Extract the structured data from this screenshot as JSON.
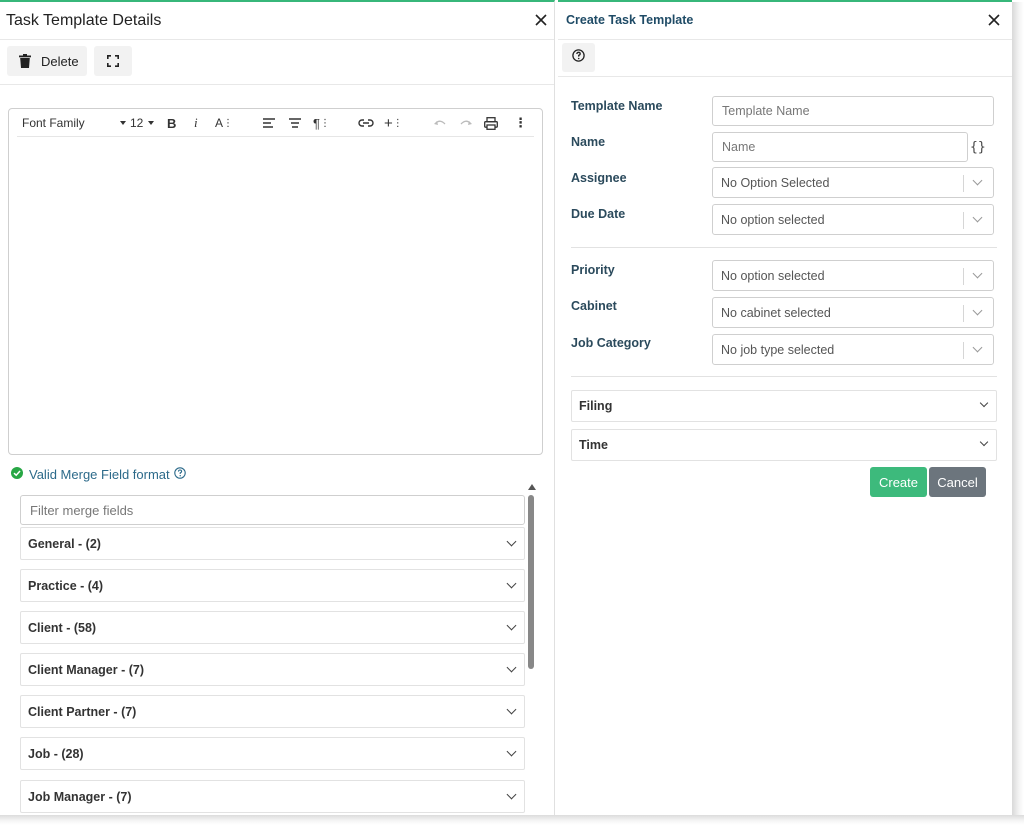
{
  "left_panel": {
    "title": "Task Template Details",
    "toolbar": {
      "delete_label": "Delete"
    },
    "editor_toolbar": {
      "font_family": "Font Family",
      "font_size": "12"
    },
    "merge": {
      "status_text": "Valid Merge Field format",
      "filter_placeholder": "Filter merge fields",
      "groups": [
        {
          "label": "General - (2)"
        },
        {
          "label": "Practice - (4)"
        },
        {
          "label": "Client - (58)"
        },
        {
          "label": "Client Manager - (7)"
        },
        {
          "label": "Client Partner - (7)"
        },
        {
          "label": "Job - (28)"
        },
        {
          "label": "Job Manager - (7)"
        }
      ]
    }
  },
  "right_panel": {
    "title": "Create Task Template",
    "fields": {
      "template_name": {
        "label": "Template Name",
        "placeholder": "Template Name"
      },
      "name": {
        "label": "Name",
        "placeholder": "Name"
      },
      "assignee": {
        "label": "Assignee",
        "value": "No Option Selected"
      },
      "due_date": {
        "label": "Due Date",
        "value": "No option selected"
      },
      "priority": {
        "label": "Priority",
        "value": "No option selected"
      },
      "cabinet": {
        "label": "Cabinet",
        "value": "No cabinet selected"
      },
      "job_category": {
        "label": "Job Category",
        "value": "No job type selected"
      }
    },
    "sections": [
      {
        "label": "Filing"
      },
      {
        "label": "Time"
      }
    ],
    "buttons": {
      "create": "Create",
      "cancel": "Cancel"
    }
  },
  "colors": {
    "accent_green": "#37b77a",
    "create_button": "#3dba7c",
    "cancel_button": "#6c757d",
    "label_blue": "#2b4a5c"
  }
}
